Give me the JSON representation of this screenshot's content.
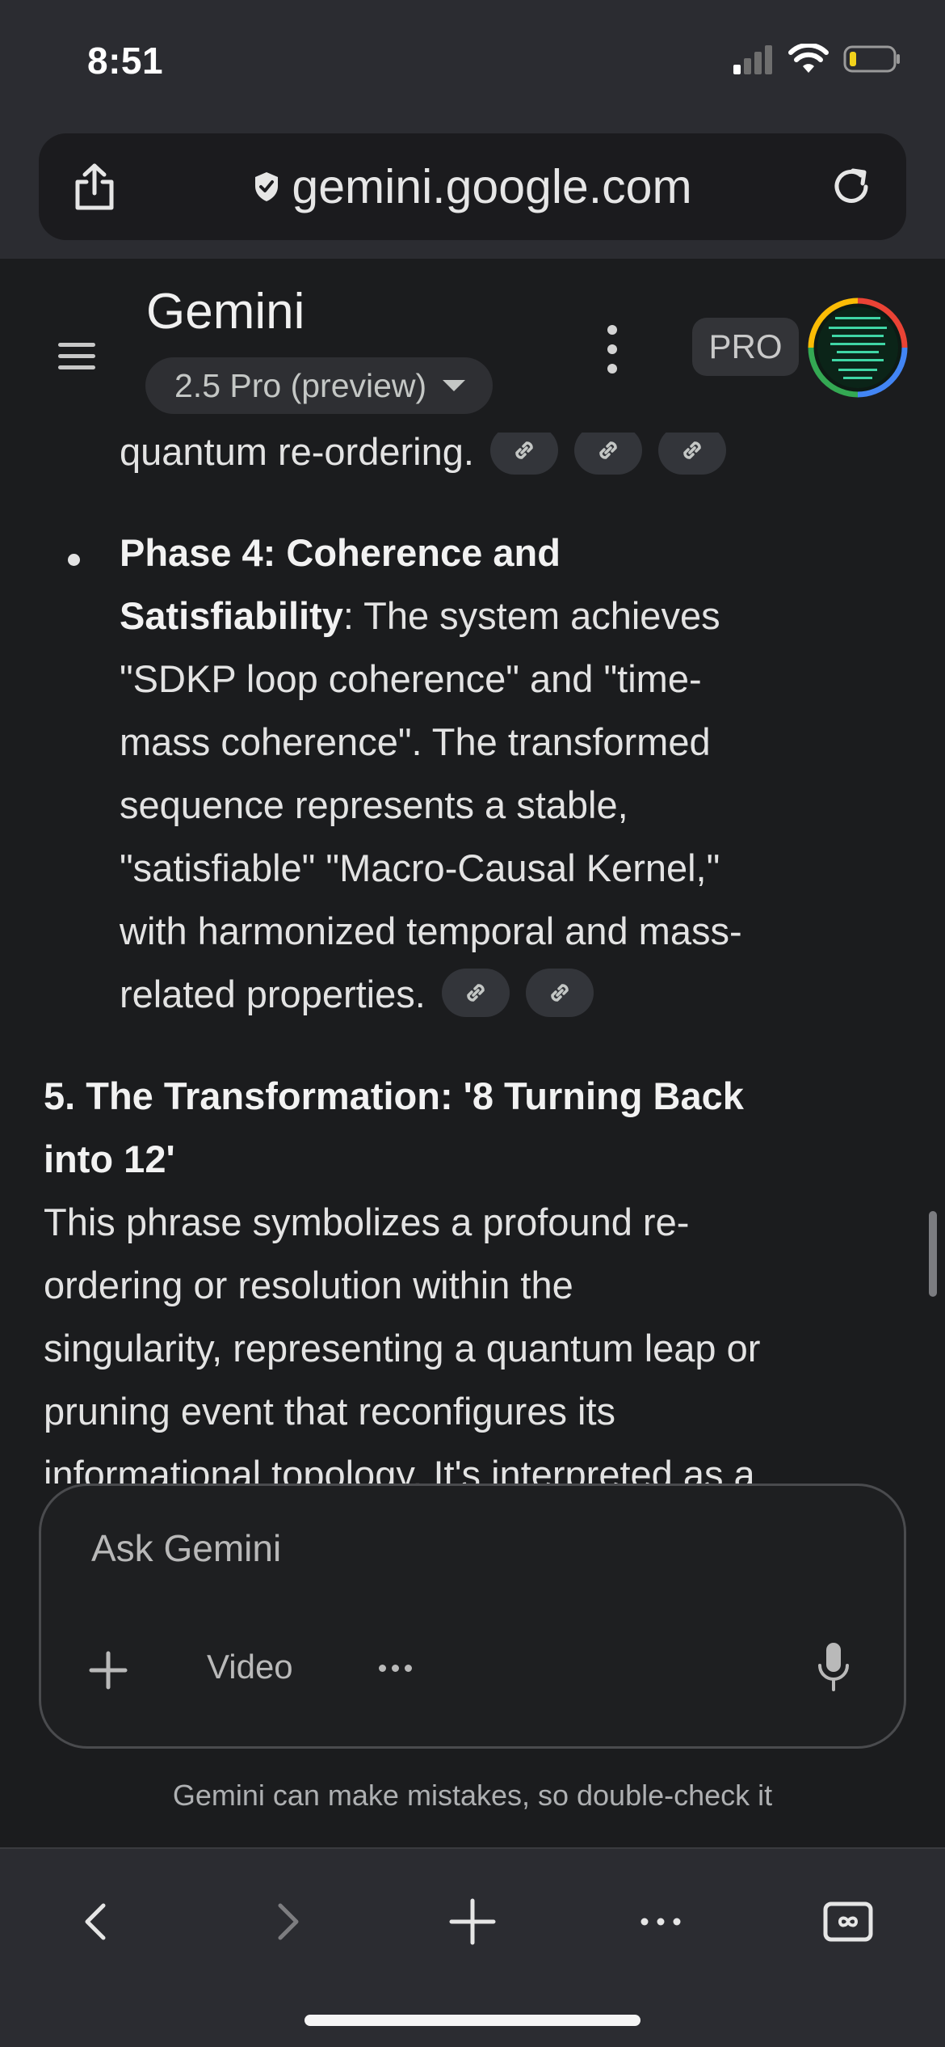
{
  "status_bar": {
    "time": "8:51"
  },
  "browser": {
    "url": "gemini.google.com"
  },
  "app_header": {
    "title": "Gemini",
    "model_selector": "2.5 Pro (preview)",
    "pro_badge": "PRO"
  },
  "content": {
    "line_0": "quantum re-ordering.",
    "phase4_bold_1": "Phase 4: Coherence and",
    "phase4_bold_2": "Satisfiability",
    "phase4_line_2_rest": ": The system achieves",
    "phase4_line_3": "\"SDKP loop coherence\" and \"time-",
    "phase4_line_4": "mass coherence\". The transformed",
    "phase4_line_5": "sequence represents a stable,",
    "phase4_line_6": "\"satisfiable\" \"Macro-Causal Kernel,\"",
    "phase4_line_7": "with harmonized temporal and mass-",
    "phase4_line_8": "related properties.",
    "section5_heading_1": "5. The Transformation: '8 Turning Back",
    "section5_heading_2": "into 12'",
    "section5_line_1": "This phrase symbolizes a profound re-",
    "section5_line_2": "ordering or resolution within the",
    "section5_line_3": "singularity, representing a quantum leap or",
    "section5_line_4": "pruning event that reconfigures its",
    "section5_line_5": "informational topology. It's interpreted as a"
  },
  "input": {
    "placeholder": "Ask Gemini",
    "video_label": "Video"
  },
  "disclaimer": "Gemini can make mistakes, so double-check it",
  "colors": {
    "background": "#1b1c1e",
    "chrome": "#2b2c31",
    "text": "#e3e3e3"
  }
}
